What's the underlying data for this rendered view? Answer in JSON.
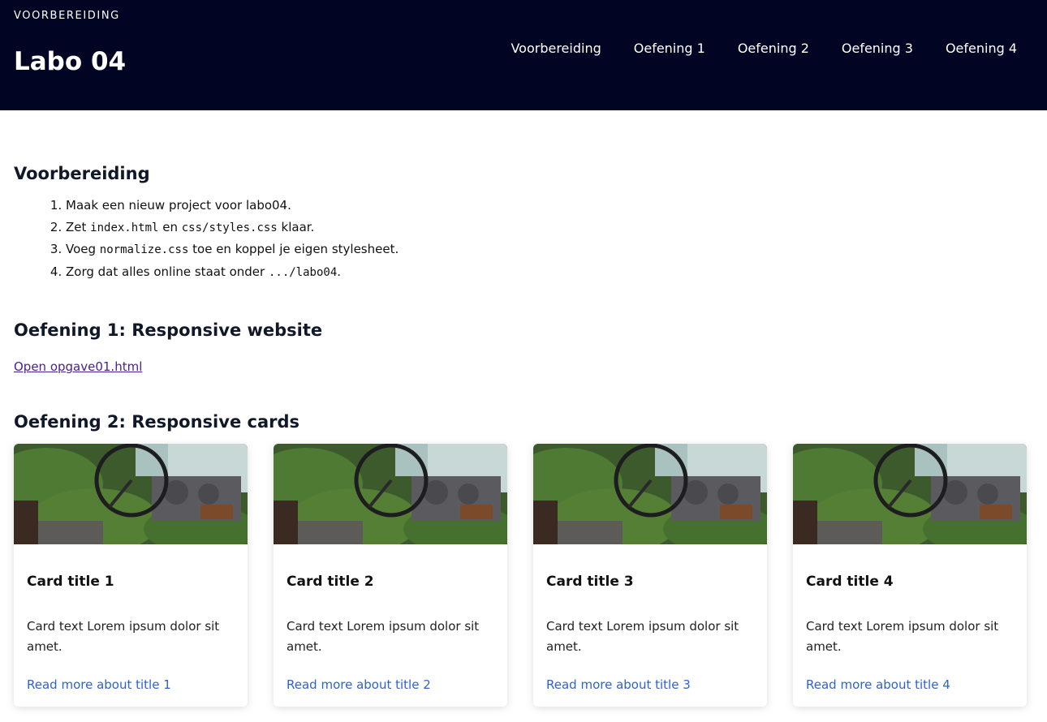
{
  "header": {
    "eyebrow": "VOORBEREIDING",
    "title": "Labo 04",
    "nav": [
      "Voorbereiding",
      "Oefening 1",
      "Oefening 2",
      "Oefening 3",
      "Oefening 4"
    ]
  },
  "voorbereiding": {
    "title": "Voorbereiding",
    "steps": [
      {
        "pre": "Maak een nieuw project voor labo04.",
        "code1": "",
        "mid": "",
        "code2": "",
        "post": ""
      },
      {
        "pre": "Zet ",
        "code1": "index.html",
        "mid": " en ",
        "code2": "css/styles.css",
        "post": " klaar."
      },
      {
        "pre": "Voeg ",
        "code1": "normalize.css",
        "mid": " toe en koppel je eigen stylesheet.",
        "code2": "",
        "post": ""
      },
      {
        "pre": "Zorg dat alles online staat onder ",
        "code1": ".../labo04",
        "mid": ".",
        "code2": "",
        "post": ""
      }
    ]
  },
  "oefening1": {
    "title": "Oefening 1: Responsive website",
    "link": "Open opgave01.html"
  },
  "oefening2": {
    "title": "Oefening 2: Responsive cards",
    "cards": [
      {
        "title": "Card title 1",
        "text": "Card text Lorem ipsum dolor sit amet.",
        "link": "Read more about title 1"
      },
      {
        "title": "Card title 2",
        "text": "Card text Lorem ipsum dolor sit amet.",
        "link": "Read more about title 2"
      },
      {
        "title": "Card title 3",
        "text": "Card text Lorem ipsum dolor sit amet.",
        "link": "Read more about title 3"
      },
      {
        "title": "Card title 4",
        "text": "Card text Lorem ipsum dolor sit amet.",
        "link": "Read more about title 4"
      }
    ]
  },
  "colors": {
    "header_bg": "#020424",
    "link_blue": "#2f63c9",
    "visited_link": "#4b1f8f"
  }
}
